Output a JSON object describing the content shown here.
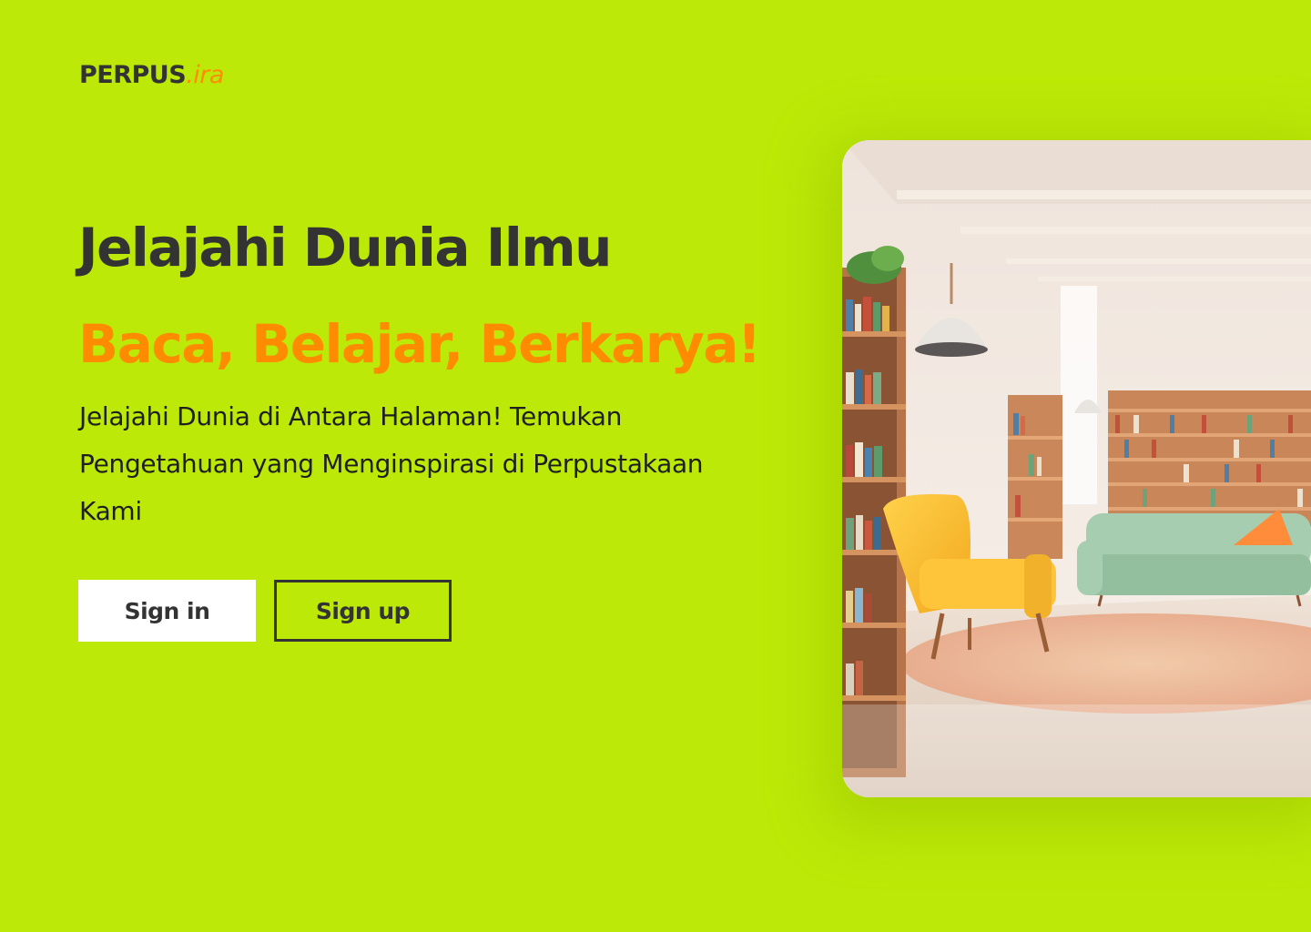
{
  "brand": {
    "name_main": "PERPUS",
    "name_accent": ".ira"
  },
  "hero": {
    "title": "Jelajahi Dunia Ilmu",
    "tagline": "Baca, Belajar, Berkarya!",
    "description": "Jelajahi Dunia di Antara Halaman! Temukan Pengetahuan yang Menginspirasi di Perpustakaan Kami"
  },
  "actions": {
    "signin_label": "Sign in",
    "signup_label": "Sign up"
  },
  "colors": {
    "background": "#bce907",
    "accent": "#ff8c00",
    "text": "#333333"
  },
  "image": {
    "subject": "library-interior-illustration-icon"
  }
}
